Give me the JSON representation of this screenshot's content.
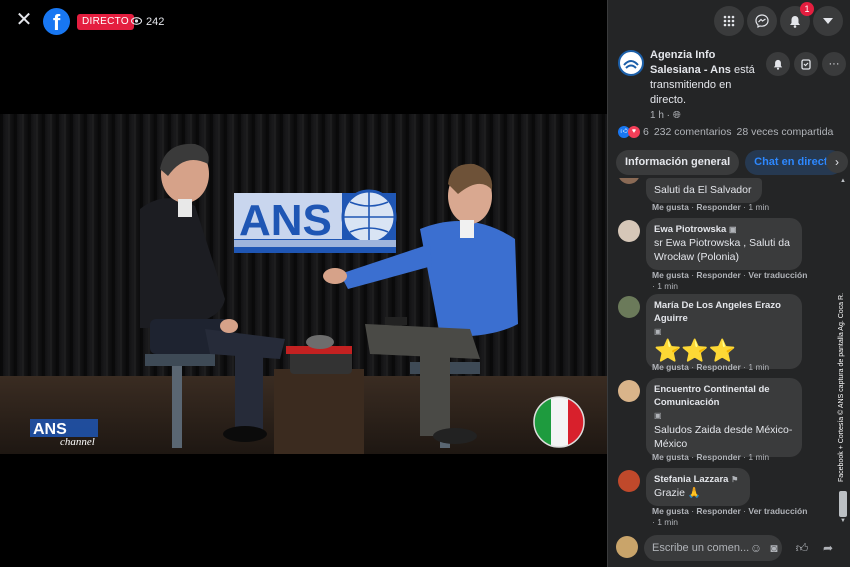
{
  "video": {
    "live_label": "DIRECTO",
    "viewer_count": "242",
    "studio_logo_text": "ANS",
    "channel_logo_text": "ANS",
    "channel_logo_sub": "channel"
  },
  "page": {
    "name": "Agenzia Info Salesiana - Ans",
    "status_text": "está transmitiendo en directo.",
    "time": "1 h"
  },
  "stats": {
    "reactions_count": "6",
    "comments": "232 comentarios",
    "shares": "28 veces compartida"
  },
  "tabs": [
    {
      "label": "Información general"
    },
    {
      "label": "Chat en directo"
    }
  ],
  "actions": {
    "like": "Me gusta",
    "reply": "Responder",
    "translate": "Ver traducción"
  },
  "comments": [
    {
      "name": "",
      "text": "Saluti da El Salvador",
      "time": "1 min"
    },
    {
      "name": "Ewa Piotrowska",
      "text": "sr Ewa Piotrowska , Saluti da Wrocław (Polonia)",
      "time": "1 min"
    },
    {
      "name": "María De Los Angeles Erazo Aguirre",
      "text": "⭐⭐⭐",
      "time": "1 min"
    },
    {
      "name": "Encuentro Continental de Comunicación",
      "text": "Saludos Zaida desde México-México",
      "time": "1 min"
    },
    {
      "name": "Stefania Lazzara",
      "text": "Grazie 🙏",
      "time": "1 min"
    }
  ],
  "composer": {
    "placeholder": "Escribe un comen..."
  },
  "credit": "Facebook + Cortesía © ANS captura de pantalla Ag. Coca R.",
  "colors": {
    "live_red": "#e41e3f",
    "fb_blue": "#1877f2",
    "sidebar_bg": "#242526",
    "bubble_bg": "#3a3b3c",
    "link_blue": "#2d88ff",
    "sweater_blue": "#3b6fd0"
  },
  "notifications": "1"
}
